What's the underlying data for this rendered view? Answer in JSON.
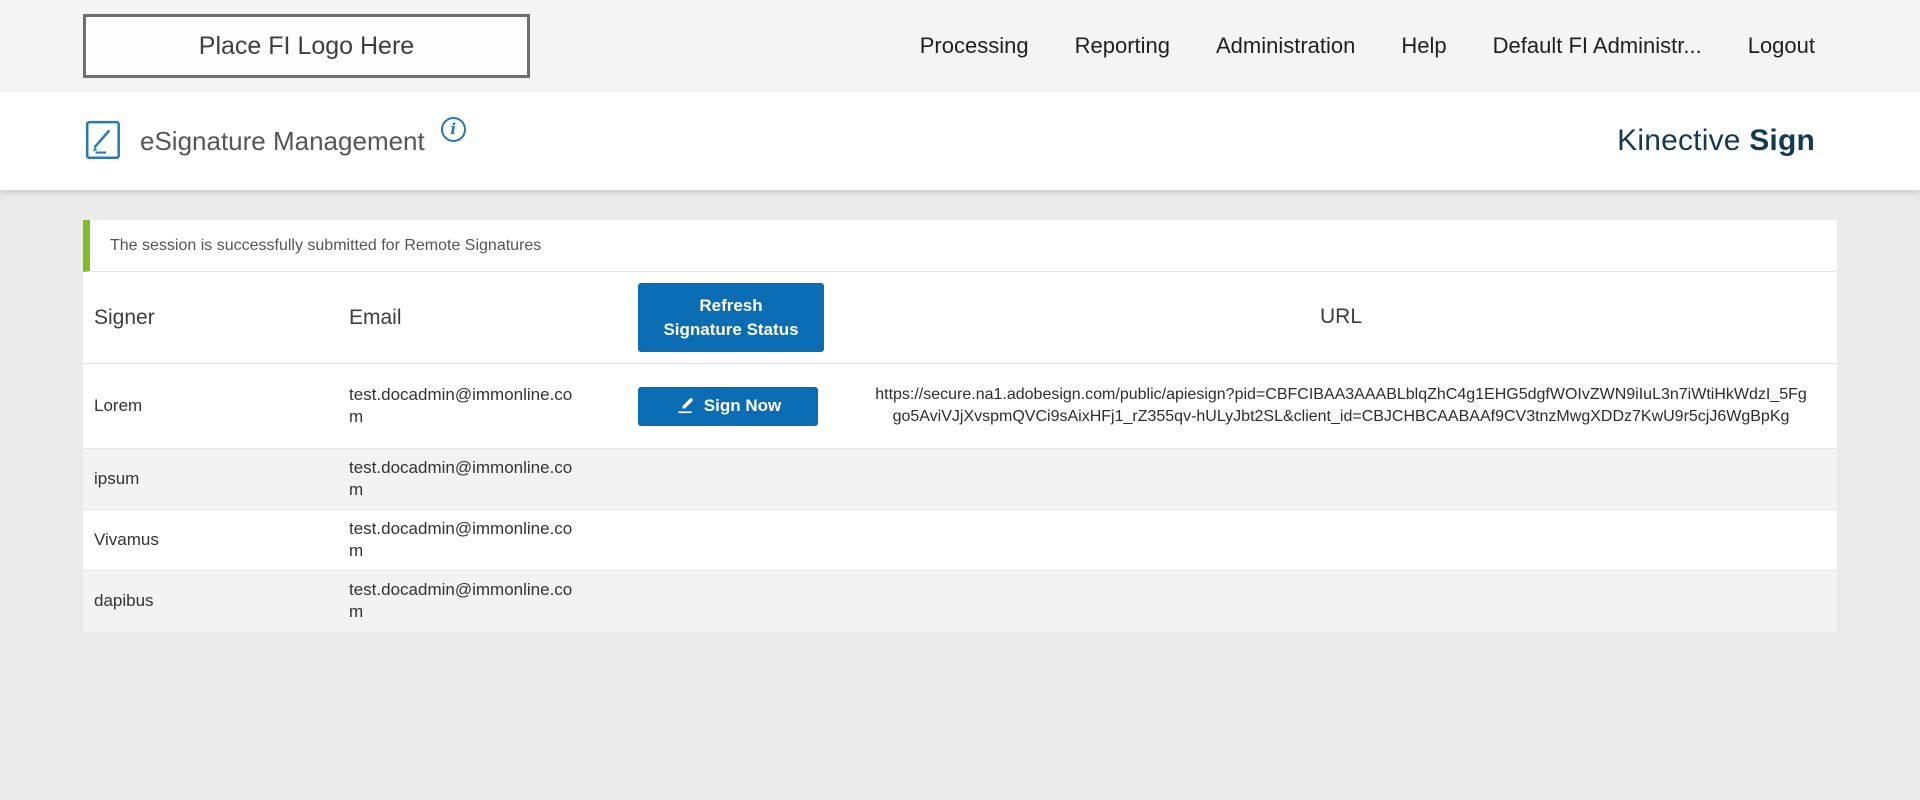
{
  "topbar": {
    "logo_text": "Place FI Logo Here",
    "nav": [
      {
        "label": "Processing"
      },
      {
        "label": "Reporting"
      },
      {
        "label": "Administration"
      },
      {
        "label": "Help"
      },
      {
        "label": "Default FI Administr..."
      },
      {
        "label": "Logout"
      }
    ]
  },
  "subheader": {
    "title": "eSignature Management",
    "brand_primary": "Kinective",
    "brand_secondary": "Sign"
  },
  "icons": {
    "info_glyph": "i"
  },
  "alert": {
    "message": "The session is successfully submitted for Remote Signatures"
  },
  "table": {
    "headers": {
      "signer": "Signer",
      "email": "Email",
      "refresh_button": "Refresh\nSignature Status",
      "url": "URL"
    },
    "sign_now_label": "Sign Now",
    "rows": [
      {
        "signer": "Lorem",
        "email": "test.docadmin@immonline.com",
        "url": "https://secure.na1.adobesign.com/public/apiesign?pid=CBFCIBAA3AAABLblqZhC4g1EHG5dgfWOIvZWN9iIuL3n7iWtiHkWdzI_5Fggo5AviVJjXvspmQVCi9sAixHFj1_rZ355qv-hULyJbt2SL&client_id=CBJCHBCAABAAf9CV3tnzMwgXDDz7KwU9r5cjJ6WgBpKg"
      },
      {
        "signer": "ipsum",
        "email": "test.docadmin@immonline.com",
        "url": ""
      },
      {
        "signer": "Vivamus",
        "email": "test.docadmin@immonline.com",
        "url": ""
      },
      {
        "signer": "dapibus",
        "email": "test.docadmin@immonline.com",
        "url": ""
      }
    ]
  },
  "colors": {
    "accent_blue": "#0a6cb2",
    "success_green": "#82ba2a",
    "brand_navy": "#123a50"
  }
}
